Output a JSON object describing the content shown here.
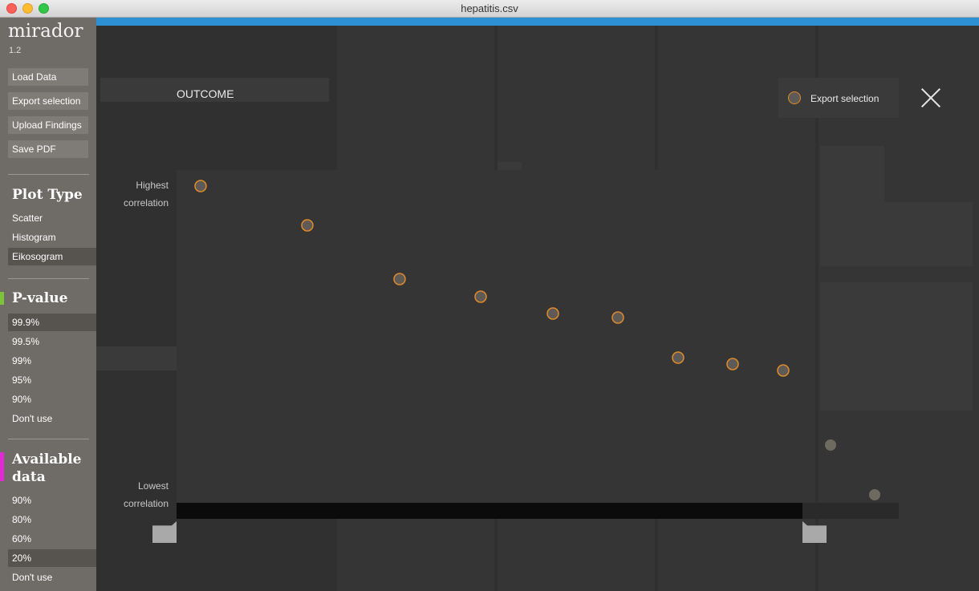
{
  "window": {
    "title": "hepatitis.csv"
  },
  "app": {
    "name": "mirador",
    "version": "1.2"
  },
  "sidebar": {
    "actions": [
      "Load Data",
      "Export selection",
      "Upload Findings",
      "Save PDF"
    ],
    "plot_type": {
      "title": "Plot Type",
      "options": [
        "Scatter",
        "Histogram",
        "Eikosogram"
      ],
      "selected": "Eikosogram"
    },
    "pvalue": {
      "title": "P-value",
      "accent": "#7cc33a",
      "options": [
        "99.9%",
        "99.5%",
        "99%",
        "95%",
        "90%",
        "Don't use"
      ],
      "selected": "99.9%"
    },
    "available": {
      "title_line1": "Available",
      "title_line2": "data",
      "accent": "#e22ad4",
      "options": [
        "90%",
        "80%",
        "60%",
        "20%",
        "Don't use"
      ],
      "selected": "20%"
    }
  },
  "panel": {
    "variable": "OUTCOME",
    "export_label": "Export selection",
    "axis_top_1": "Highest",
    "axis_top_2": "correlation",
    "axis_bottom_1": "Lowest",
    "axis_bottom_2": "correlation"
  },
  "colors": {
    "accent_blue": "#2d8fd4",
    "point_stroke": "#e08a2a",
    "point_fill": "#5e5a57",
    "point_dim": "#6e6a60"
  },
  "icons": {
    "close": "close-icon",
    "legend": "circle-icon"
  }
}
